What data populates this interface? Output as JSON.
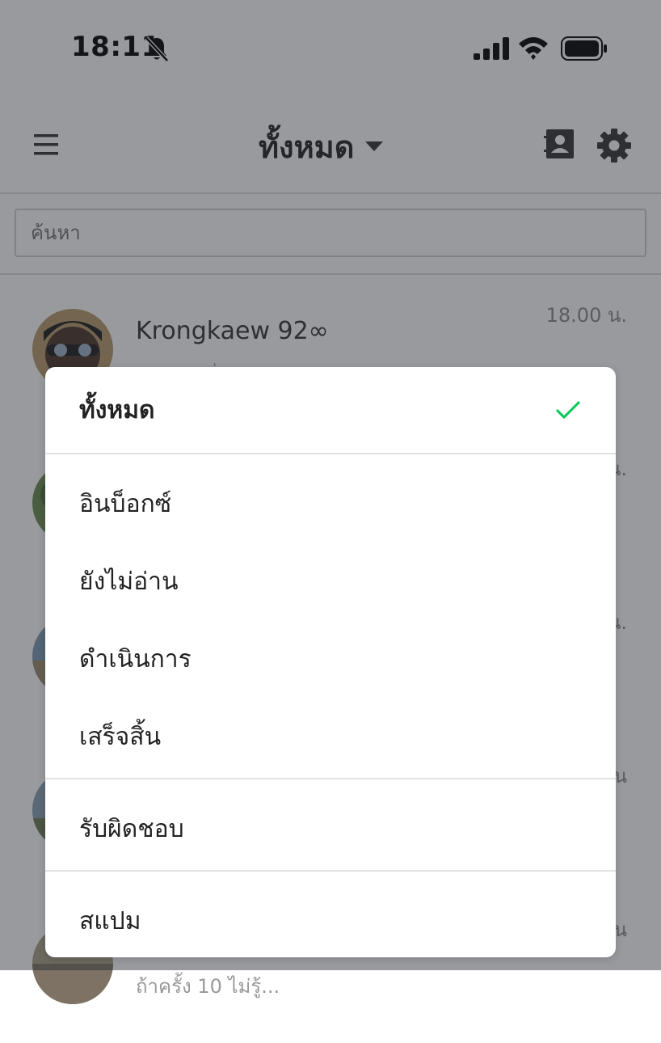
{
  "status_bar": {
    "time": "18:11",
    "icons": [
      "bell-slash-icon",
      "signal-icon",
      "wifi-icon",
      "battery-icon"
    ]
  },
  "header": {
    "title": "ทั้งหมด",
    "icons": [
      "menu-icon",
      "caret-down-icon",
      "contacts-icon",
      "settings-icon"
    ]
  },
  "search": {
    "placeholder": "ค้นหา"
  },
  "chats": [
    {
      "name": "Krongkaew 92",
      "name_suffix": "∞",
      "preview": "ขอบคุณค่ะ",
      "time": "18.00 น."
    },
    {
      "name": "",
      "preview": "",
      "time": "น."
    },
    {
      "name": "",
      "preview": "",
      "time": "น."
    },
    {
      "name": "",
      "preview": "",
      "time": "น"
    },
    {
      "name": "",
      "preview": "ถ้าครั้ง 10 ไม่รู้...",
      "time": "น"
    }
  ],
  "filter_menu": {
    "options": [
      {
        "label": "ทั้งหมด",
        "selected": true
      },
      {
        "label": "อินบ็อกซ์",
        "selected": false
      },
      {
        "label": "ยังไม่อ่าน",
        "selected": false
      },
      {
        "label": "ดำเนินการ",
        "selected": false
      },
      {
        "label": "เสร็จสิ้น",
        "selected": false
      },
      {
        "label": "รับผิดชอบ",
        "selected": false
      },
      {
        "label": "สแปม",
        "selected": false
      }
    ],
    "check_color": "#06c755"
  },
  "colors": {
    "overlay": "rgba(40,44,52,0.48)",
    "text_primary": "#222222",
    "accent_check": "#06c755"
  }
}
